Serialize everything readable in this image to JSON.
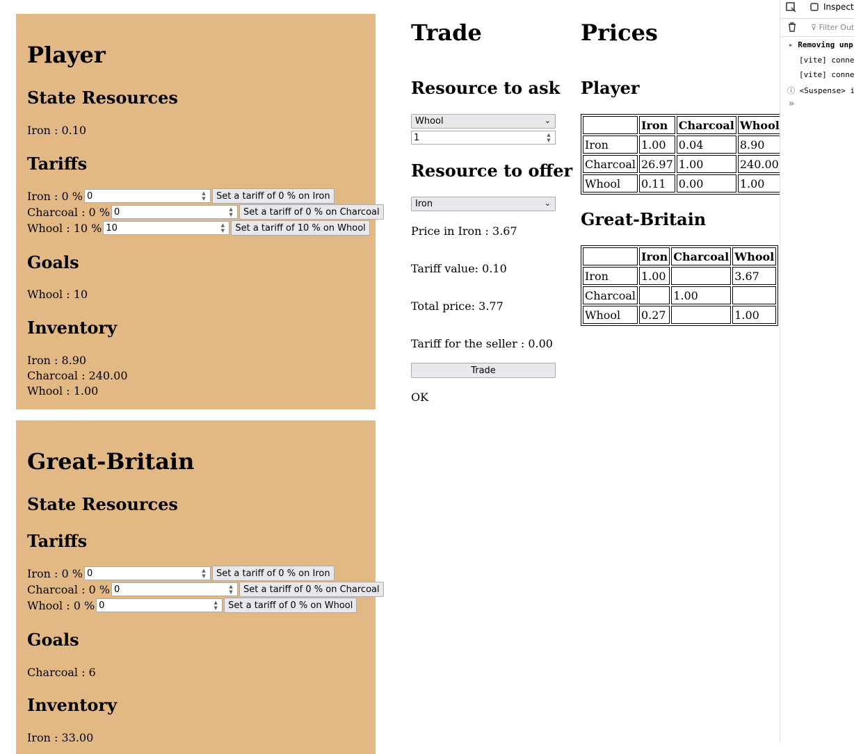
{
  "player": {
    "name": "Player",
    "state_resources_heading": "State Resources",
    "state_resources": [
      "Iron : 0.10"
    ],
    "tariffs_heading": "Tariffs",
    "tariffs": [
      {
        "label": "Iron : 0 %",
        "value": "0",
        "button": "Set a tariff of 0 % on Iron"
      },
      {
        "label": "Charcoal : 0 %",
        "value": "0",
        "button": "Set a tariff of 0 % on Charcoal"
      },
      {
        "label": "Whool : 10 %",
        "value": "10",
        "button": "Set a tariff of 10 % on Whool"
      }
    ],
    "goals_heading": "Goals",
    "goals": [
      "Whool : 10"
    ],
    "inventory_heading": "Inventory",
    "inventory": [
      "Iron : 8.90",
      "Charcoal : 240.00",
      "Whool : 1.00"
    ]
  },
  "great_britain": {
    "name": "Great-Britain",
    "state_resources_heading": "State Resources",
    "tariffs_heading": "Tariffs",
    "tariffs": [
      {
        "label": "Iron : 0 %",
        "value": "0",
        "button": "Set a tariff of 0 % on Iron"
      },
      {
        "label": "Charcoal : 0 %",
        "value": "0",
        "button": "Set a tariff of 0 % on Charcoal"
      },
      {
        "label": "Whool : 0 %",
        "value": "0",
        "button": "Set a tariff of 0 % on Whool"
      }
    ],
    "goals_heading": "Goals",
    "goals": [
      "Charcoal : 6"
    ],
    "inventory_heading": "Inventory",
    "inventory": [
      "Iron : 33.00"
    ]
  },
  "trade": {
    "title": "Trade",
    "ask_heading": "Resource to ask",
    "ask_selected": "Whool",
    "ask_quantity": "1",
    "offer_heading": "Resource to offer",
    "offer_selected": "Iron",
    "price_text": "Price in Iron : 3.67",
    "tariff_value_text": "Tariff value: 0.10",
    "total_price_text": "Total price: 3.77",
    "seller_tariff_text": "Tariff for the seller : 0.00",
    "trade_button": "Trade",
    "status": "OK"
  },
  "prices": {
    "title": "Prices",
    "tables": [
      {
        "name": "Player",
        "columns": [
          "",
          "Iron",
          "Charcoal",
          "Whool"
        ],
        "rows": [
          [
            "Iron",
            "1.00",
            "0.04",
            "8.90"
          ],
          [
            "Charcoal",
            "26.97",
            "1.00",
            "240.00"
          ],
          [
            "Whool",
            "0.11",
            "0.00",
            "1.00"
          ]
        ]
      },
      {
        "name": "Great-Britain",
        "columns": [
          "",
          "Iron",
          "Charcoal",
          "Whool"
        ],
        "rows": [
          [
            "Iron",
            "1.00",
            "",
            "3.67"
          ],
          [
            "Charcoal",
            "",
            "1.00",
            ""
          ],
          [
            "Whool",
            "0.27",
            "",
            "1.00"
          ]
        ]
      }
    ]
  },
  "devtools": {
    "inspector_label": "Inspecto",
    "filter_placeholder": "Filter Outp",
    "console_lines": [
      "Removing unp",
      "[vite] conne",
      "[vite] conne",
      "<Suspense> i"
    ]
  }
}
